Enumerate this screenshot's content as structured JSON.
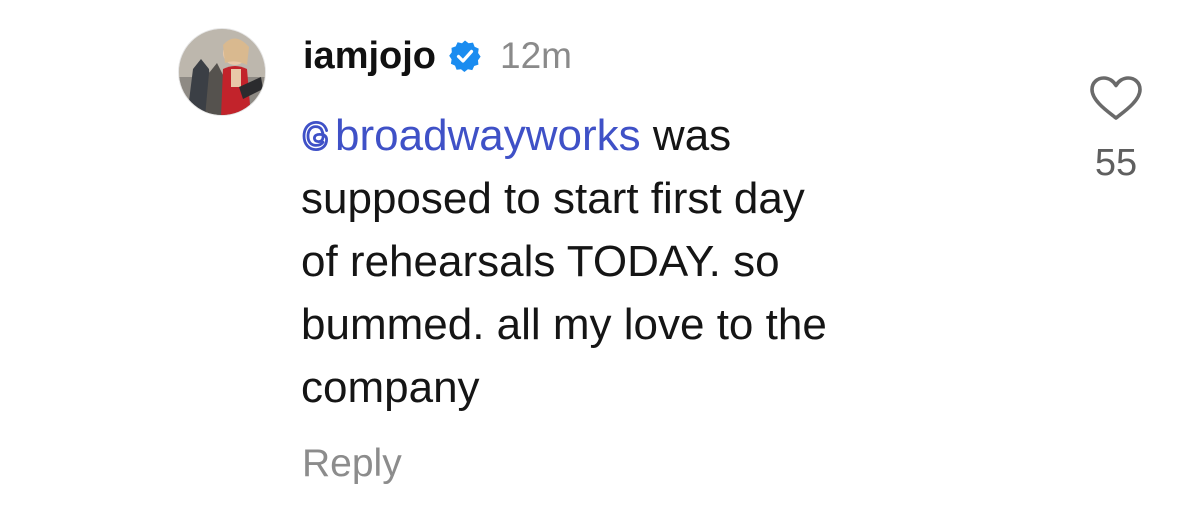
{
  "comment": {
    "username": "iamjojo",
    "verified_icon": "verified-badge-icon",
    "timestamp": "12m",
    "mention": "broadwayworks",
    "text_after_mention": " was",
    "lines": [
      "supposed to start first day",
      "of rehearsals TODAY. so",
      "bummed. all my love to the",
      "company"
    ],
    "reply_label": "Reply",
    "like_icon": "heart-outline-icon",
    "like_count": "55"
  },
  "colors": {
    "mention": "#3f51c7",
    "verified": "#1a8cf0",
    "secondary_text": "#8a8a8a",
    "primary_text": "#151515"
  }
}
